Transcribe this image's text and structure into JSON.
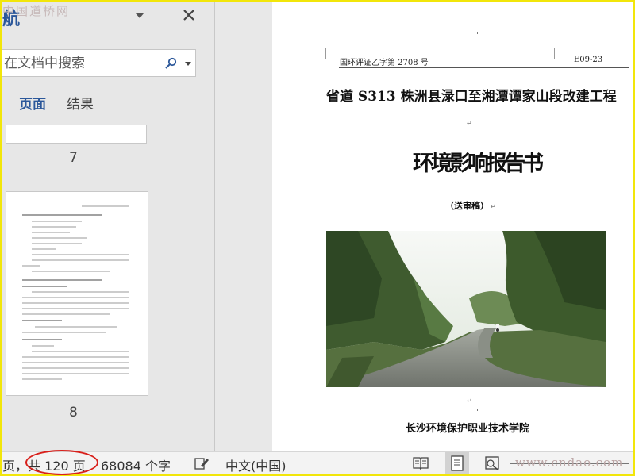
{
  "nav": {
    "title": "航",
    "watermark": "中国道桥网",
    "search_placeholder": "在文档中搜索",
    "tabs": [
      {
        "label": "页面"
      },
      {
        "label": "结果"
      }
    ],
    "thumbnails": [
      {
        "page_number": "7"
      },
      {
        "page_number": "8"
      }
    ]
  },
  "document": {
    "header_left": "国环评证乙字第 2708 号",
    "header_right": "E09-23",
    "title": "省道 S313 株洲县渌口至湘潭谭家山段改建工程",
    "report_title": "环境影响报告书",
    "review_draft": "（送审稿）",
    "institute": "长沙环境保护职业技术学院",
    "paragraph_mark": "↵"
  },
  "status_bar": {
    "pages": "页，共 120 页",
    "words": "68084 个字",
    "language": "中文(中国)",
    "watermark": "www.cndao.com"
  }
}
